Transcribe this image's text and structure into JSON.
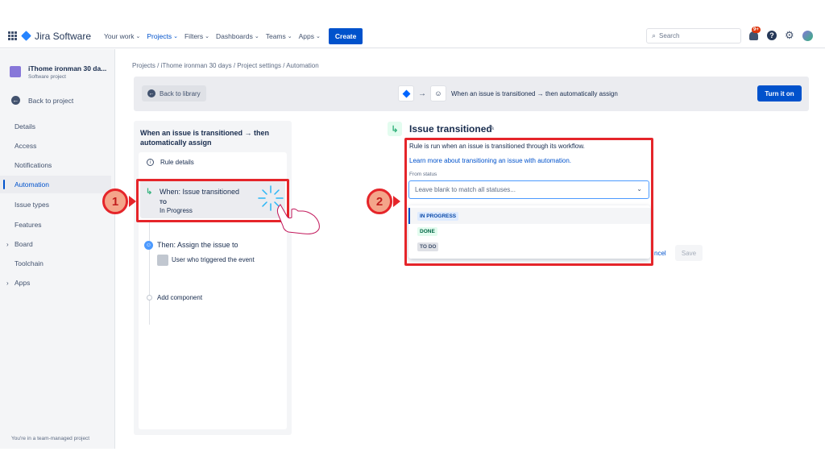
{
  "nav": {
    "app_name": "Jira Software",
    "items": [
      {
        "label": "Your work",
        "active": false
      },
      {
        "label": "Projects",
        "active": true
      },
      {
        "label": "Filters",
        "active": false
      },
      {
        "label": "Dashboards",
        "active": false
      },
      {
        "label": "Teams",
        "active": false
      },
      {
        "label": "Apps",
        "active": false
      }
    ],
    "create_label": "Create",
    "search_placeholder": "Search",
    "notification_badge": "9+",
    "help_symbol": "?"
  },
  "sidebar": {
    "project_name": "iThome ironman 30 da...",
    "project_type": "Software project",
    "back_label": "Back to project",
    "items": [
      {
        "label": "Details"
      },
      {
        "label": "Access"
      },
      {
        "label": "Notifications"
      },
      {
        "label": "Automation"
      },
      {
        "label": "Issue types"
      },
      {
        "label": "Features"
      },
      {
        "label": "Board"
      },
      {
        "label": "Toolchain"
      },
      {
        "label": "Apps"
      }
    ],
    "footer": "You're in a team-managed project"
  },
  "breadcrumb": "Projects  /  iThome ironman 30 days  /  Project settings  /  Automation",
  "banner": {
    "back_label": "Back to library",
    "summary": "When an issue is transitioned → then automatically assign",
    "turn_on_label": "Turn it on"
  },
  "rule": {
    "title": "When an issue is transitioned → then automatically assign",
    "details_label": "Rule details",
    "when_title": "When: Issue transitioned",
    "when_to_label": "TO",
    "when_status": "In Progress",
    "then_title": "Then: Assign the issue to",
    "then_user": "User who triggered the event",
    "add_component": "Add component"
  },
  "trigger": {
    "title": "Issue transitioned",
    "description": "Rule is run when an issue is transitioned through its workflow.",
    "learn_link": "Learn more about transitioning an issue with automation.",
    "from_status_label": "From status",
    "from_status_placeholder": "Leave blank to match all statuses...",
    "options": [
      {
        "label": "IN PROGRESS",
        "color": "#0747A6"
      },
      {
        "label": "DONE",
        "color": "#006644"
      },
      {
        "label": "TO DO",
        "color": "#42526E"
      }
    ],
    "cancel_label": "ncel",
    "save_label": "Save"
  },
  "annotations": {
    "marker1": "1",
    "marker2": "2",
    "highlight_color": "#E5252A"
  }
}
